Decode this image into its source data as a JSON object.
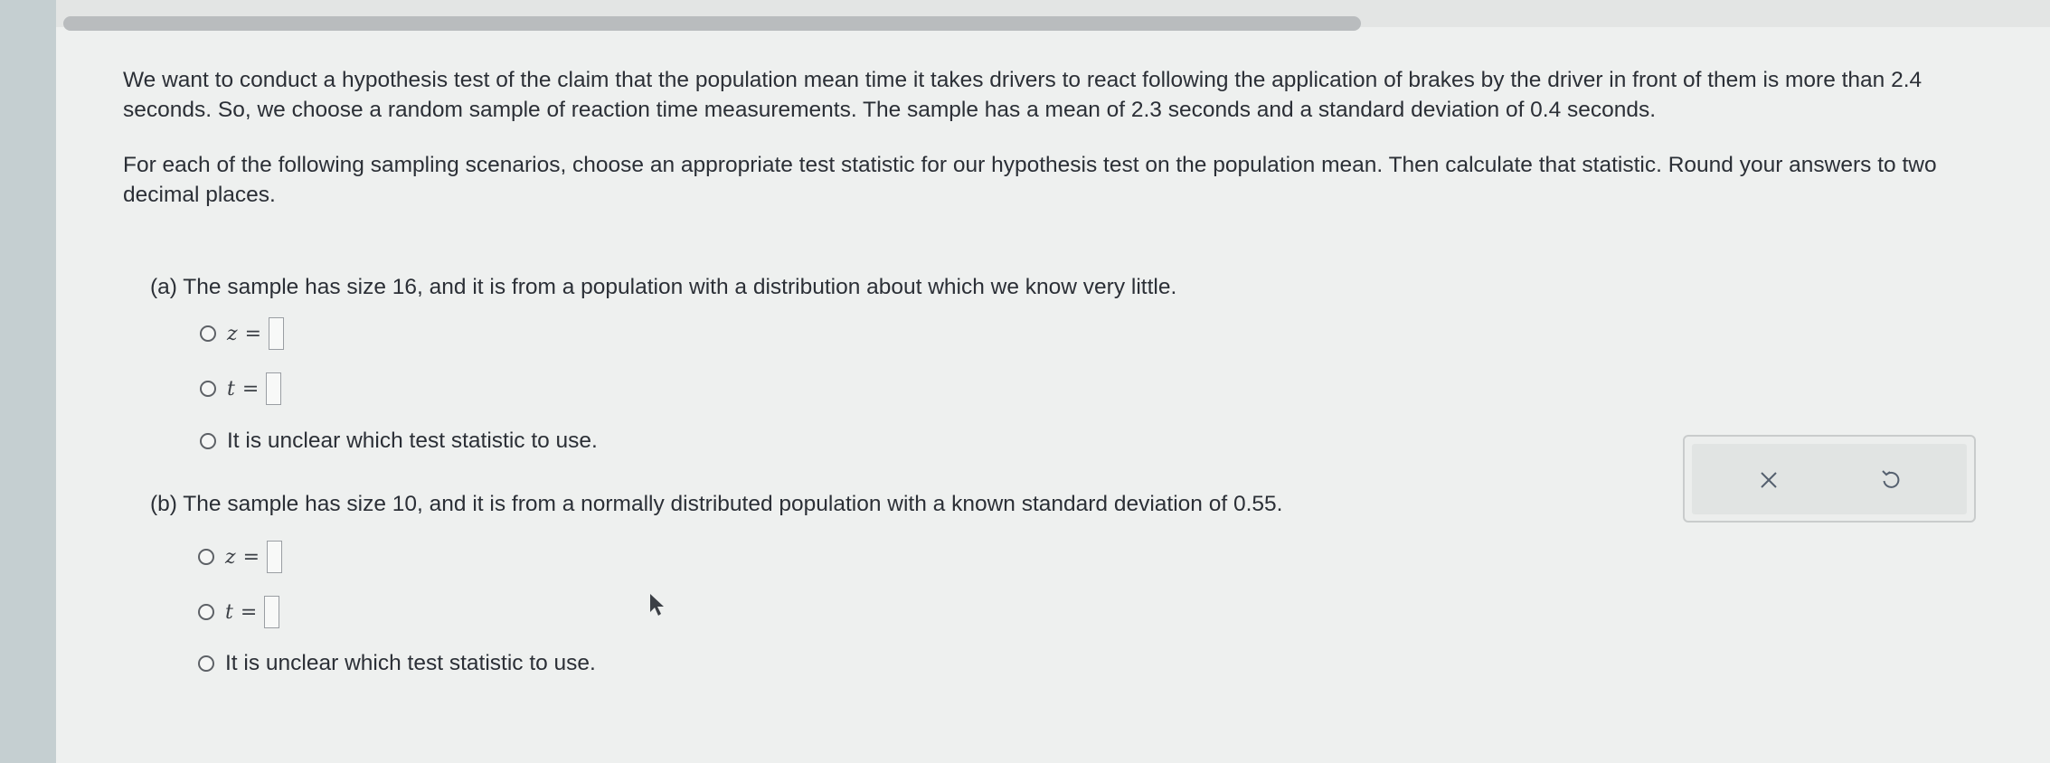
{
  "question": {
    "intro": "We want to conduct a hypothesis test of the claim that the population mean time it takes drivers to react following the application of brakes by the driver in front of them is more than 2.4 seconds. So, we choose a random sample of reaction time measurements. The sample has a mean of 2.3 seconds and a standard deviation of 0.4 seconds.",
    "instructions": "For each of the following sampling scenarios, choose an appropriate test statistic for our hypothesis test on the population mean. Then calculate that statistic. Round your answers to two decimal places."
  },
  "parts": [
    {
      "title": "(a) The sample has size 16, and it is from a population with a distribution about which we know very little.",
      "options": [
        {
          "var": "z",
          "eq": "=",
          "value": ""
        },
        {
          "var": "t",
          "eq": "=",
          "value": ""
        },
        {
          "label": "It is unclear which test statistic to use."
        }
      ]
    },
    {
      "title": "(b) The sample has size 10, and it is from a normally distributed population with a known standard deviation of 0.55.",
      "options": [
        {
          "var": "z",
          "eq": "=",
          "value": ""
        },
        {
          "var": "t",
          "eq": "=",
          "value": ""
        },
        {
          "label": "It is unclear which test statistic to use."
        }
      ]
    }
  ],
  "toolbar": {
    "clear_icon": "close-icon",
    "undo_icon": "undo-icon"
  },
  "colors": {
    "text": "#2b2f36",
    "radio_border": "#5d6166",
    "box_border": "#9a9ea3"
  }
}
